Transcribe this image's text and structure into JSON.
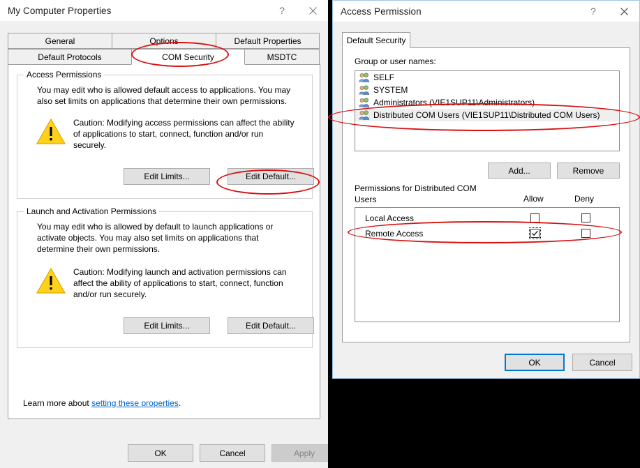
{
  "left_dialog": {
    "title": "My Computer Properties",
    "titlebar_buttons": {
      "help": "?",
      "close": "✕"
    },
    "tabs_row1": [
      {
        "label": "General",
        "selected": false
      },
      {
        "label": "Options",
        "selected": false
      },
      {
        "label": "Default Properties",
        "selected": false
      }
    ],
    "tabs_row2": [
      {
        "label": "Default Protocols",
        "selected": false
      },
      {
        "label": "COM Security",
        "selected": true
      },
      {
        "label": "MSDTC",
        "selected": false
      }
    ],
    "access_permissions": {
      "legend": "Access Permissions",
      "description_line1": "You may edit who is allowed default access to applications. You may",
      "description_line2": "also set limits on applications that determine their own permissions.",
      "caution_line1": "Caution: Modifying access permissions can affect the ability",
      "caution_line2": "of applications to start, connect, function and/or run",
      "caution_line3": "securely.",
      "edit_limits": "Edit Limits...",
      "edit_default": "Edit Default..."
    },
    "launch_permissions": {
      "legend": "Launch and Activation Permissions",
      "description_line1": "You may edit who is allowed by default to launch applications or",
      "description_line2": "activate objects. You may also set limits on applications that",
      "description_line3": "determine their own permissions.",
      "caution_line1": "Caution: Modifying launch and activation permissions can",
      "caution_line2": "affect the ability of applications to start, connect, function",
      "caution_line3": "and/or run securely.",
      "edit_limits": "Edit Limits...",
      "edit_default": "Edit Default..."
    },
    "learn_more_prefix": "Learn more about ",
    "learn_more_link": "setting these properties",
    "learn_more_suffix": ".",
    "footer": {
      "ok": "OK",
      "cancel": "Cancel",
      "apply": "Apply",
      "apply_disabled": true
    }
  },
  "right_dialog": {
    "title": "Access Permission",
    "titlebar_buttons": {
      "help": "?",
      "close": "✕"
    },
    "tabs": [
      {
        "label": "Default Security",
        "selected": true
      }
    ],
    "group_label": "Group or user names:",
    "users": [
      {
        "name": "SELF",
        "selected": false
      },
      {
        "name": "SYSTEM",
        "selected": false
      },
      {
        "name": "Administrators (VIE1SUP11\\Administrators)",
        "selected": false
      },
      {
        "name": "Distributed COM Users (VIE1SUP11\\Distributed COM Users)",
        "selected": true
      }
    ],
    "add_button": "Add...",
    "remove_button": "Remove",
    "permissions_label_line1": "Permissions for Distributed COM",
    "permissions_label_line2": "Users",
    "columns": [
      "Allow",
      "Deny"
    ],
    "permissions": [
      {
        "name": "Local Access",
        "allow": false,
        "deny": false,
        "focused": false
      },
      {
        "name": "Remote Access",
        "allow": true,
        "deny": false,
        "focused": true
      }
    ],
    "footer": {
      "ok": "OK",
      "cancel": "Cancel"
    }
  },
  "annotation_color": "#d81010"
}
